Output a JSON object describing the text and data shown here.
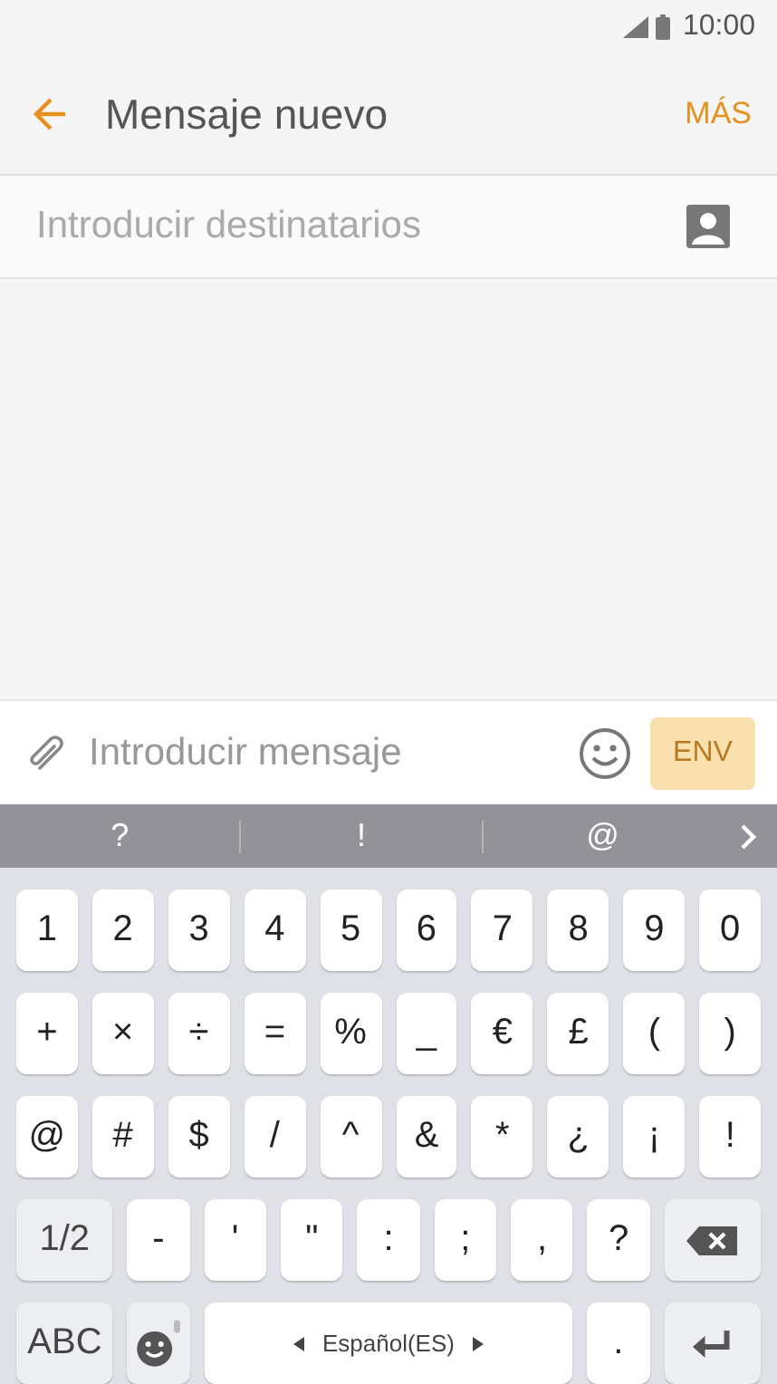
{
  "status_bar": {
    "time": "10:00"
  },
  "header": {
    "title": "Mensaje nuevo",
    "more": "MÁS"
  },
  "recipients": {
    "placeholder": "Introducir destinatarios"
  },
  "composer": {
    "placeholder": "Introducir mensaje",
    "send": {
      "label": "ENV",
      "disabled": true
    }
  },
  "suggestions": [
    "?",
    "!",
    "@"
  ],
  "keyboard": {
    "rows": [
      {
        "keys": [
          {
            "kind": "char",
            "label": "1"
          },
          {
            "kind": "char",
            "label": "2"
          },
          {
            "kind": "char",
            "label": "3"
          },
          {
            "kind": "char",
            "label": "4"
          },
          {
            "kind": "char",
            "label": "5"
          },
          {
            "kind": "char",
            "label": "6"
          },
          {
            "kind": "char",
            "label": "7"
          },
          {
            "kind": "char",
            "label": "8"
          },
          {
            "kind": "char",
            "label": "9"
          },
          {
            "kind": "char",
            "label": "0"
          }
        ]
      },
      {
        "keys": [
          {
            "kind": "char",
            "label": "+"
          },
          {
            "kind": "char",
            "label": "×"
          },
          {
            "kind": "char",
            "label": "÷"
          },
          {
            "kind": "char",
            "label": "="
          },
          {
            "kind": "char",
            "label": "%"
          },
          {
            "kind": "char",
            "label": "_"
          },
          {
            "kind": "char",
            "label": "€"
          },
          {
            "kind": "char",
            "label": "£"
          },
          {
            "kind": "char",
            "label": "("
          },
          {
            "kind": "char",
            "label": ")"
          }
        ]
      },
      {
        "keys": [
          {
            "kind": "char",
            "label": "@"
          },
          {
            "kind": "char",
            "label": "#"
          },
          {
            "kind": "char",
            "label": "$"
          },
          {
            "kind": "char",
            "label": "/"
          },
          {
            "kind": "char",
            "label": "^"
          },
          {
            "kind": "char",
            "label": "&"
          },
          {
            "kind": "char",
            "label": "*"
          },
          {
            "kind": "char",
            "label": "¿"
          },
          {
            "kind": "char",
            "label": "¡"
          },
          {
            "kind": "char",
            "label": "!"
          }
        ]
      },
      {
        "keys": [
          {
            "kind": "mode",
            "label": "1/2"
          },
          {
            "kind": "char",
            "label": "-"
          },
          {
            "kind": "char",
            "label": "'"
          },
          {
            "kind": "char",
            "label": "\""
          },
          {
            "kind": "char",
            "label": ":"
          },
          {
            "kind": "char",
            "label": ";"
          },
          {
            "kind": "char",
            "label": ","
          },
          {
            "kind": "char",
            "label": "?"
          },
          {
            "kind": "backspace"
          }
        ]
      },
      {
        "keys": [
          {
            "kind": "mode",
            "label": "ABC"
          },
          {
            "kind": "emoji"
          },
          {
            "kind": "space",
            "label": "Español(ES)"
          },
          {
            "kind": "char",
            "label": "."
          },
          {
            "kind": "enter"
          }
        ]
      }
    ]
  }
}
